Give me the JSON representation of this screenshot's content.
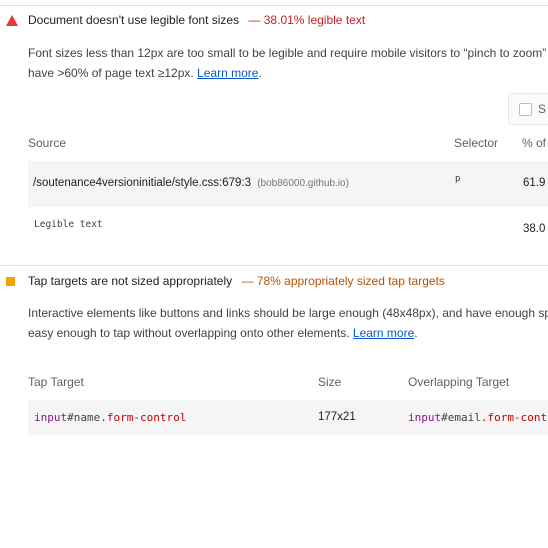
{
  "audit_font": {
    "title": "Document doesn't use legible font sizes",
    "score_text": "— 38.01% legible text",
    "desc_line1": "Font sizes less than 12px are too small to be legible and require mobile visitors to “pinch to zoom”",
    "desc_line2_prefix": "have >60% of page text ≥12px.",
    "learn_more": "Learn more",
    "period": ".",
    "checkbox_label": "S",
    "columns": [
      "Source",
      "Selector",
      "% of"
    ],
    "rows": [
      {
        "source": "/soutenance4versioninitiale/style.css:679:3",
        "domain": "(bob86000.github.io)",
        "selector": "p",
        "percent": "61.9"
      },
      {
        "source": "Legible text",
        "selector": "",
        "percent": "38.0"
      }
    ]
  },
  "audit_tap": {
    "title": "Tap targets are not sized appropriately",
    "score_text": "— 78% appropriately sized tap targets",
    "desc_line1": "Interactive elements like buttons and links should be large enough (48x48px), and have enough sp",
    "desc_line2_prefix": "easy enough to tap without overlapping onto other elements.",
    "learn_more": "Learn more",
    "period": ".",
    "columns": [
      "Tap Target",
      "Size",
      "Overlapping Target"
    ],
    "rows": [
      {
        "target_tag": "input",
        "target_id": "#name",
        "target_class": ".form-control",
        "size": "177x21",
        "overlap_tag": "input",
        "overlap_id": "#email",
        "overlap_class": ".form-contr"
      }
    ]
  },
  "colors": {
    "fail": "#e53935",
    "warn": "#f4a300",
    "link": "#0b57d0"
  }
}
